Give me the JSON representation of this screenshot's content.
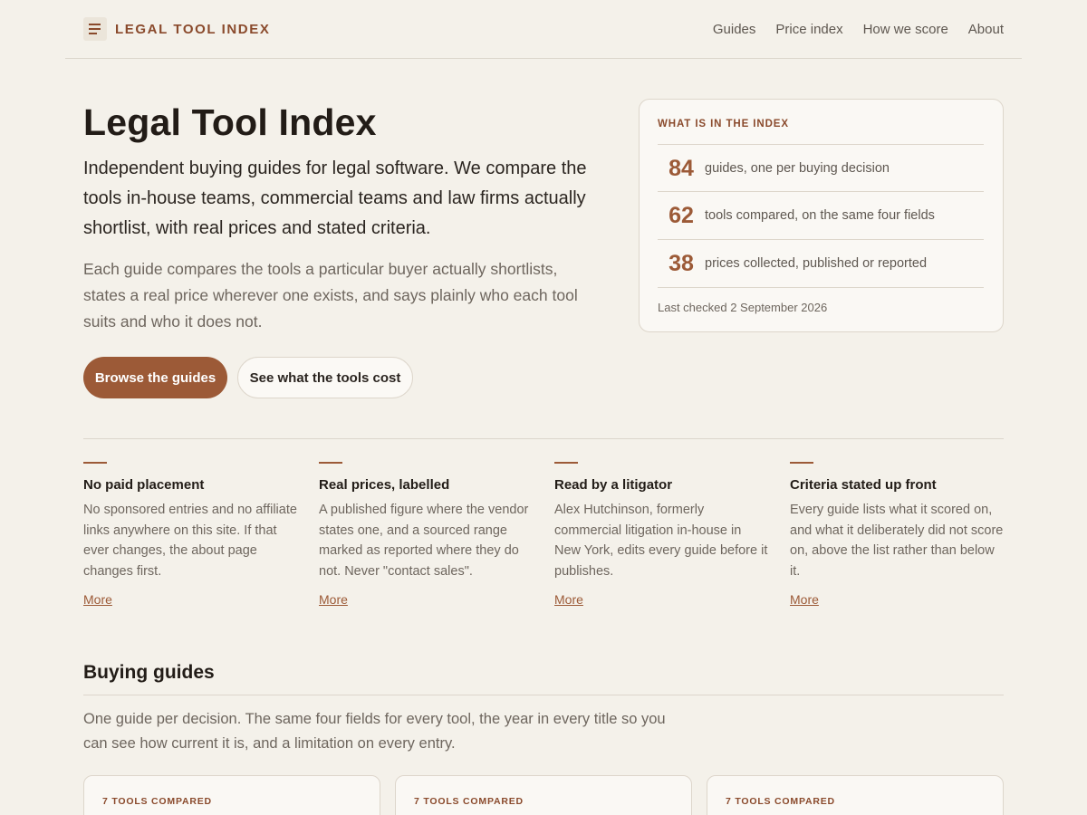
{
  "header": {
    "brand": "LEGAL TOOL INDEX",
    "nav": [
      "Guides",
      "Price index",
      "How we score",
      "About"
    ]
  },
  "hero": {
    "title": "Legal Tool Index",
    "lead": "Independent buying guides for legal software. We compare the tools in-house teams, commercial teams and law firms actually shortlist, with real prices and stated criteria.",
    "sub": "Each guide compares the tools a particular buyer actually shortlists, states a real price wherever one exists, and says plainly who each tool suits and who it does not.",
    "primary_button": "Browse the guides",
    "secondary_button": "See what the tools cost"
  },
  "stats": {
    "kicker": "WHAT IS IN THE INDEX",
    "items": [
      {
        "value": "84",
        "label": "guides, one per buying decision"
      },
      {
        "value": "62",
        "label": "tools compared, on the same four fields"
      },
      {
        "value": "38",
        "label": "prices collected, published or reported"
      }
    ],
    "footnote": "Last checked 2 September 2026"
  },
  "features": [
    {
      "title": "No paid placement",
      "text": "No sponsored entries and no affiliate links anywhere on this site. If that ever changes, the about page changes first.",
      "link": "More"
    },
    {
      "title": "Real prices, labelled",
      "text": "A published figure where the vendor states one, and a sourced range marked as reported where they do not. Never \"contact sales\".",
      "link": "More"
    },
    {
      "title": "Read by a litigator",
      "text": "Alex Hutchinson, formerly commercial litigation in-house in New York, edits every guide before it publishes.",
      "link": "More"
    },
    {
      "title": "Criteria stated up front",
      "text": "Every guide lists what it scored on, and what it deliberately did not score on, above the list rather than below it.",
      "link": "More"
    }
  ],
  "guides": {
    "title": "Buying guides",
    "sub": "One guide per decision. The same four fields for every tool, the year in every title so you can see how current it is, and a limitation on every entry.",
    "cards": [
      {
        "kicker": "7 TOOLS COMPARED"
      },
      {
        "kicker": "7 TOOLS COMPARED"
      },
      {
        "kicker": "7 TOOLS COMPARED"
      }
    ]
  },
  "colors": {
    "background": "#f4f1ea",
    "accent": "#9c5a37",
    "brand": "#8a4a2c",
    "card": "#faf8f4"
  }
}
